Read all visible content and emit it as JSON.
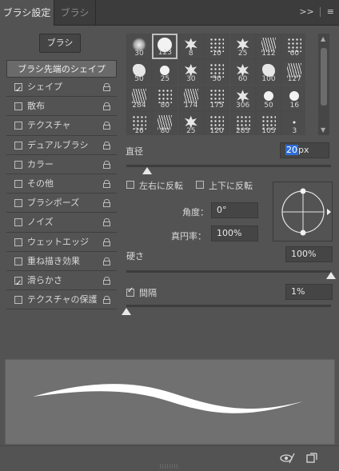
{
  "tabs": [
    {
      "label": "ブラシ設定",
      "active": true
    },
    {
      "label": "ブラシ",
      "active": false
    }
  ],
  "tab_tools": {
    "collapse_icon": "double-chevron-right-icon",
    "menu_icon": "hamburger-menu-icon"
  },
  "brush_button": "ブラシ",
  "tip_shape_label": "ブラシ先端のシェイプ",
  "settings": [
    {
      "label": "シェイプ",
      "checked": true
    },
    {
      "label": "散布",
      "checked": false
    },
    {
      "label": "テクスチャ",
      "checked": false
    },
    {
      "label": "デュアルブラシ",
      "checked": false
    },
    {
      "label": "カラー",
      "checked": false
    },
    {
      "label": "その他",
      "checked": false
    },
    {
      "label": "ブラシポーズ",
      "checked": false
    },
    {
      "label": "ノイズ",
      "checked": false
    },
    {
      "label": "ウェットエッジ",
      "checked": false
    },
    {
      "label": "重ね描き効果",
      "checked": false
    },
    {
      "label": "滑らかさ",
      "checked": true
    },
    {
      "label": "テクスチャの保護",
      "checked": false
    }
  ],
  "presets": [
    {
      "size": "30",
      "kind": "soft"
    },
    {
      "size": "123",
      "kind": "round",
      "selected": true
    },
    {
      "size": "8",
      "kind": "splat"
    },
    {
      "size": "10",
      "kind": "scatter"
    },
    {
      "size": "25",
      "kind": "splat"
    },
    {
      "size": "112",
      "kind": "grass"
    },
    {
      "size": "60",
      "kind": "scatter"
    },
    {
      "size": "50",
      "kind": "blob"
    },
    {
      "size": "25",
      "kind": "round"
    },
    {
      "size": "30",
      "kind": "splat"
    },
    {
      "size": "50",
      "kind": "scatter"
    },
    {
      "size": "60",
      "kind": "splat"
    },
    {
      "size": "100",
      "kind": "blob"
    },
    {
      "size": "127",
      "kind": "grass"
    },
    {
      "size": "284",
      "kind": "grass"
    },
    {
      "size": "80",
      "kind": "scatter"
    },
    {
      "size": "174",
      "kind": "grass"
    },
    {
      "size": "175",
      "kind": "scatter"
    },
    {
      "size": "306",
      "kind": "splat"
    },
    {
      "size": "50",
      "kind": "round"
    },
    {
      "size": "16",
      "kind": "round"
    },
    {
      "size": "16",
      "kind": "scatter"
    },
    {
      "size": "80",
      "kind": "grass"
    },
    {
      "size": "25",
      "kind": "splat"
    },
    {
      "size": "120",
      "kind": "scatter"
    },
    {
      "size": "283",
      "kind": "scatter"
    },
    {
      "size": "105",
      "kind": "scatter"
    },
    {
      "size": "3",
      "kind": "round"
    }
  ],
  "diameter": {
    "label": "直径",
    "value": "20",
    "unit": "px",
    "slider_fraction": 0.1
  },
  "flip_x": {
    "label": "左右に反転",
    "checked": false
  },
  "flip_y": {
    "label": "上下に反転",
    "checked": false
  },
  "angle": {
    "label": "角度：",
    "value": "0°"
  },
  "roundness": {
    "label": "真円率：",
    "value": "100%"
  },
  "hardness": {
    "label": "硬さ",
    "value": "100%",
    "slider_fraction": 1.0
  },
  "spacing": {
    "label": "間隔",
    "value": "1%",
    "checked": true,
    "slider_fraction": 0.0
  },
  "footer_icons": [
    "visibility-toggle-icon",
    "new-preset-icon"
  ],
  "colors": {
    "panel": "#535353",
    "tabbar": "#3c3c3c",
    "highlight": "#2f6ed9",
    "preview_bg": "#707070"
  }
}
